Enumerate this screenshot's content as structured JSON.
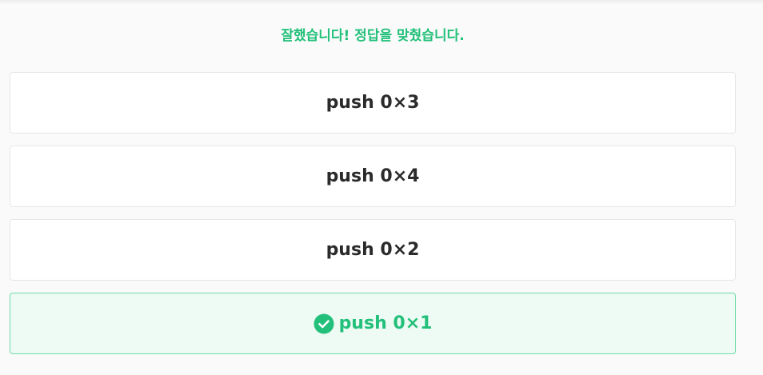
{
  "feedback": {
    "message": "잘했습니다! 정답을 맞췄습니다."
  },
  "options": [
    {
      "label": "push 0×3",
      "state": "default"
    },
    {
      "label": "push 0×4",
      "state": "default"
    },
    {
      "label": "push 0×2",
      "state": "default"
    },
    {
      "label": "push 0×1",
      "state": "correct",
      "icon": "check-circle-icon"
    }
  ],
  "colors": {
    "accent_green": "#22c07a",
    "correct_bg": "#eefaf4",
    "correct_border": "#6fdcaa",
    "option_border": "#e6e6e6",
    "text_dark": "#2b2b2b",
    "page_bg": "#fafafa"
  }
}
